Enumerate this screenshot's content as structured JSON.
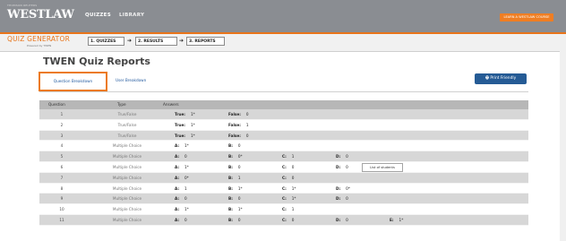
{
  "header": {
    "brand_small": "THOMSON REUTERS",
    "brand": "WESTLAW",
    "nav": [
      "QUIZZES",
      "LIBRARY"
    ],
    "orange_button": "LEARN A WESTLAW COURSE",
    "accent": "#e8741a"
  },
  "subheader": {
    "title": "QUIZ GENERATOR",
    "powered": "Powered by TWEN",
    "steps": [
      "1. QUIZZES",
      "2. RESULTS",
      "3. REPORTS"
    ],
    "arrow": "➔"
  },
  "page": {
    "title": "TWEN Quiz Reports",
    "tabs": [
      "Question Breakdown",
      "User Breakdown"
    ],
    "print_button": "🖶 Print Friendly"
  },
  "table": {
    "headers": [
      "Question",
      "Type",
      "Answers"
    ],
    "rows": [
      {
        "q": "1",
        "type": "True/False",
        "answers": [
          [
            "True:",
            "1*"
          ],
          [
            "False:",
            "0"
          ]
        ]
      },
      {
        "q": "2",
        "type": "True/False",
        "answers": [
          [
            "True:",
            "1*"
          ],
          [
            "False:",
            "1"
          ]
        ]
      },
      {
        "q": "3",
        "type": "True/False",
        "answers": [
          [
            "True:",
            "1*"
          ],
          [
            "False:",
            "0"
          ]
        ]
      },
      {
        "q": "4",
        "type": "Multiple Choice",
        "answers": [
          [
            "A:",
            "1*"
          ],
          [
            "B:",
            "0"
          ]
        ]
      },
      {
        "q": "5",
        "type": "Multiple Choice",
        "answers": [
          [
            "A:",
            "0"
          ],
          [
            "B:",
            "0*"
          ],
          [
            "C:",
            "1"
          ],
          [
            "D:",
            "0"
          ]
        ]
      },
      {
        "q": "6",
        "type": "Multiple Choice",
        "answers": [
          [
            "A:",
            "1*"
          ],
          [
            "B:",
            "0"
          ],
          [
            "C:",
            "0"
          ],
          [
            "D:",
            "0"
          ]
        ],
        "tooltip": "List of students"
      },
      {
        "q": "7",
        "type": "Multiple Choice",
        "answers": [
          [
            "A:",
            "0*"
          ],
          [
            "B:",
            "1"
          ],
          [
            "C:",
            "0"
          ]
        ]
      },
      {
        "q": "8",
        "type": "Multiple Choice",
        "answers": [
          [
            "A:",
            "1"
          ],
          [
            "B:",
            "1*"
          ],
          [
            "C:",
            "1*"
          ],
          [
            "D:",
            "0*"
          ]
        ]
      },
      {
        "q": "9",
        "type": "Multiple Choice",
        "answers": [
          [
            "A:",
            "0"
          ],
          [
            "B:",
            "0"
          ],
          [
            "C:",
            "1*"
          ],
          [
            "D:",
            "0"
          ]
        ]
      },
      {
        "q": "10",
        "type": "Multiple Choice",
        "answers": [
          [
            "A:",
            "1*"
          ],
          [
            "B:",
            "1*"
          ],
          [
            "C:",
            "1"
          ]
        ]
      },
      {
        "q": "11",
        "type": "Multiple Choice",
        "answers": [
          [
            "A:",
            "0"
          ],
          [
            "B:",
            "0"
          ],
          [
            "C:",
            "0"
          ],
          [
            "D:",
            "0"
          ],
          [
            "E:",
            "1*"
          ]
        ]
      }
    ]
  }
}
